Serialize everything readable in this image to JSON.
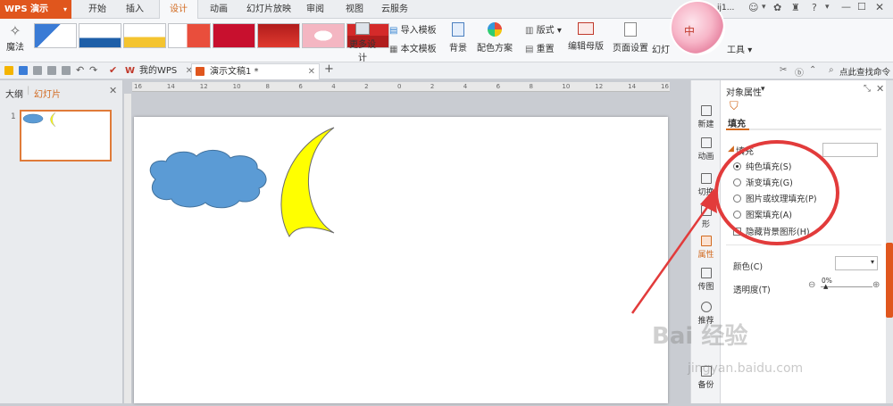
{
  "app": {
    "title": "WPS 演示"
  },
  "menu": {
    "tabs": [
      "开始",
      "插入",
      "设计",
      "动画",
      "幻灯片放映",
      "审阅",
      "视图",
      "云服务"
    ],
    "active_tab": "设计"
  },
  "ribbon": {
    "magic": "魔法",
    "more_design": "更多设计",
    "import_template": "导入模板",
    "this_template": "本文模板",
    "background": "背景",
    "color_scheme": "配色方案",
    "layout": "版式",
    "reset": "重置",
    "edit_master": "编辑母版",
    "page_setup": "页面设置",
    "slide_size": "幻灯",
    "tools": "工具",
    "zhong": "中"
  },
  "quickbar": {
    "my_wps": "我的WPS",
    "doc_tab": "演示文稿1 *",
    "find_cmd": "点此查找命令",
    "user_short": "jj1..."
  },
  "left_panel": {
    "outline_tab": "大纲",
    "slides_tab": "幻灯片",
    "slide_number": "1"
  },
  "ruler_labels": [
    "16",
    "14",
    "12",
    "10",
    "8",
    "6",
    "4",
    "2",
    "0",
    "2",
    "4",
    "6",
    "8",
    "10",
    "12",
    "14",
    "16"
  ],
  "right_sidebar": {
    "items": [
      "新建",
      "动画",
      "切换",
      "形",
      "属性",
      "传图",
      "推荐",
      "备份"
    ]
  },
  "props": {
    "title": "对象属性",
    "fill_tab": "填充",
    "section_fill": "填充",
    "options": [
      {
        "label": "纯色填充(S)",
        "selected": true
      },
      {
        "label": "渐变填充(G)",
        "selected": false
      },
      {
        "label": "图片或纹理填充(P)",
        "selected": false
      },
      {
        "label": "图案填充(A)",
        "selected": false
      }
    ],
    "hide_bg": "隐藏背景图形(H)",
    "color_label": "颜色(C)",
    "transparency_label": "透明度(T)",
    "transparency_value": "0%"
  },
  "watermark": {
    "brand": "Bai 经验",
    "url": "jingyan.baidu.com"
  },
  "colors": {
    "accent": "#e0561d",
    "cloud": "#5b9bd5",
    "moon": "#ffff00",
    "annotation": "#e23b3b"
  }
}
